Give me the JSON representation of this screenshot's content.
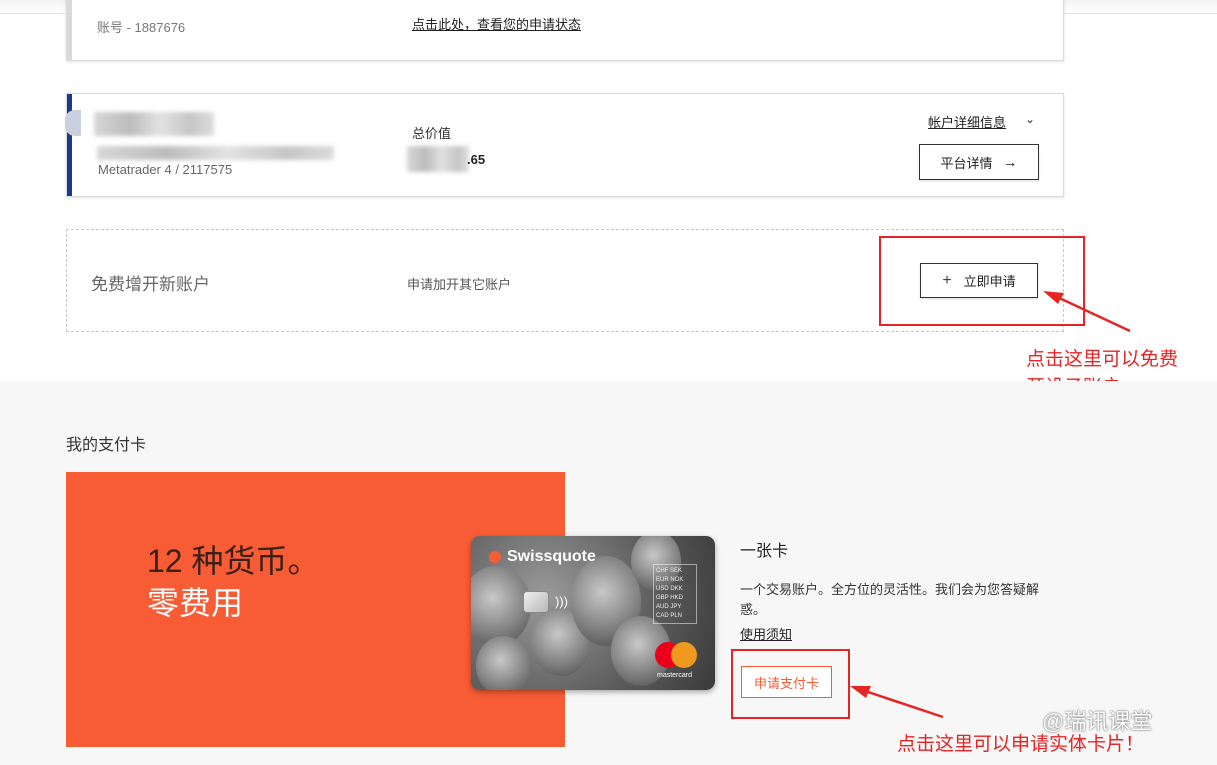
{
  "account1": {
    "account_number": "账号 - 1887676",
    "status_link": "点击此处，查看您的申请状态"
  },
  "account2": {
    "platform": "Metatrader 4 / 2117575",
    "total_label": "总价值",
    "total_value": ".65",
    "details_link": "帐户详细信息",
    "platform_button": "平台详情",
    "accent_color": "#1d3a8a"
  },
  "new_account": {
    "title": "免费增开新账户",
    "description": "申请加开其它账户",
    "button": "立即申请"
  },
  "annotations": {
    "note1_line1": "点击这里可以免费",
    "note1_line2": "开设子账户",
    "note2": "点击这里可以申请实体卡片！",
    "color": "#e52525"
  },
  "cards_section": {
    "title": "我的支付卡",
    "promo_line1": "12 种货币。",
    "promo_line2": "零费用",
    "promo_color": "#f85c35",
    "card_brand": "Swissquote",
    "card_currencies": "CHF SEK EUR NOK USD DKK GBP HKD AUD JPY CAD PLN",
    "card_network": "mastercard",
    "card_title": "一张卡",
    "card_description": "一个交易账户。全方位的灵活性。我们会为您答疑解惑。",
    "terms_link": "使用须知",
    "apply_button": "申请支付卡"
  },
  "watermark": "@瑞讯课堂"
}
